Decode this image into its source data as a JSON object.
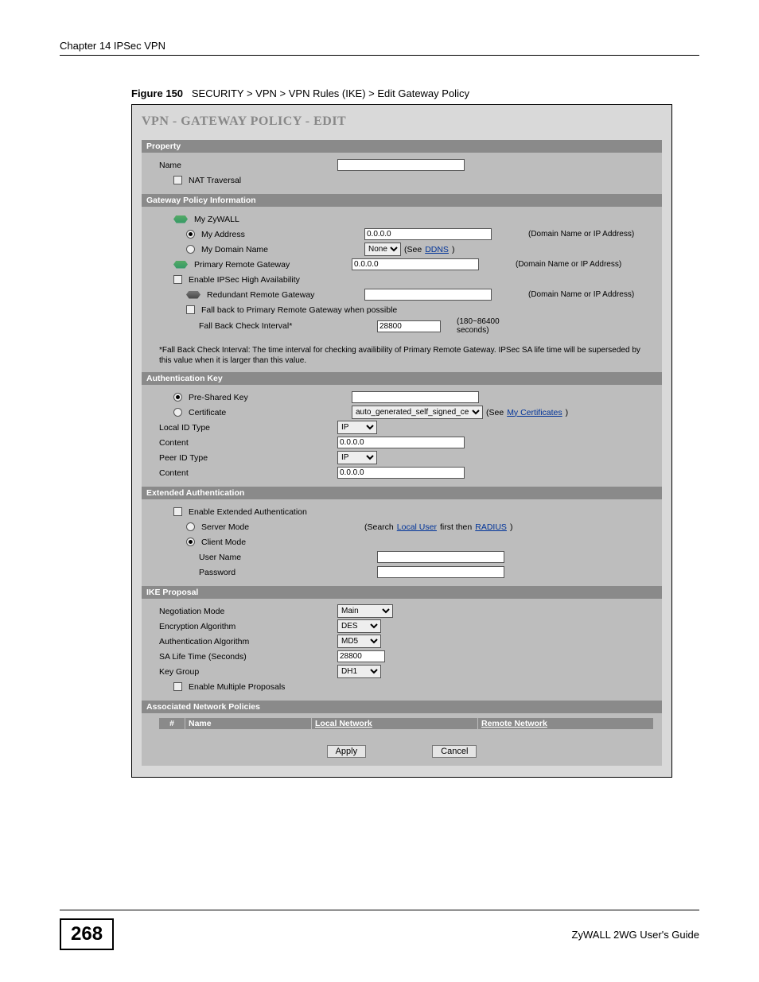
{
  "header": {
    "running": "Chapter 14 IPSec VPN"
  },
  "figure": {
    "label": "Figure 150",
    "path": "SECURITY > VPN > VPN Rules (IKE) > Edit Gateway Policy"
  },
  "panel": {
    "title": "VPN - GATEWAY POLICY - EDIT"
  },
  "property": {
    "bar": "Property",
    "name_label": "Name",
    "nat_traversal": "NAT Traversal"
  },
  "gpi": {
    "bar": "Gateway Policy Information",
    "my_zywall": "My ZyWALL",
    "my_address": "My Address",
    "my_address_value": "0.0.0.0",
    "my_domain_name": "My Domain Name",
    "domain_select": "None",
    "see": "(See ",
    "ddns": "DDNS",
    "close": ")",
    "primary_remote": "Primary Remote Gateway",
    "primary_remote_value": "0.0.0.0",
    "enable_ipsec_ha": "Enable IPSec High Availability",
    "redundant": "Redundant Remote Gateway",
    "fallback": "Fall back to Primary Remote Gateway when possible",
    "fallback_interval": "Fall Back Check Interval*",
    "fallback_value": "28800",
    "fallback_range": "(180~86400 seconds)",
    "hint_domain": "(Domain Name or IP Address)",
    "note": "*Fall Back Check Interval: The time interval for checking availibility of Primary Remote Gateway. IPSec SA life time will be superseded by this value when it is larger than this value."
  },
  "auth": {
    "bar": "Authentication Key",
    "psk": "Pre-Shared Key",
    "cert": "Certificate",
    "cert_value": "auto_generated_self_signed_cert",
    "see": "(See ",
    "my_certs": "My Certificates",
    "close": ")",
    "local_id_type": "Local ID Type",
    "local_id_type_value": "IP",
    "content1": "Content",
    "content1_value": "0.0.0.0",
    "peer_id_type": "Peer ID Type",
    "peer_id_type_value": "IP",
    "content2": "Content",
    "content2_value": "0.0.0.0"
  },
  "ext": {
    "bar": "Extended Authentication",
    "enable": "Enable Extended Authentication",
    "server_mode": "Server Mode",
    "search_pre": "(Search ",
    "local_user": "Local User",
    "mid": " first then ",
    "radius": "RADIUS",
    "close": ")",
    "client_mode": "Client Mode",
    "user_name": "User Name",
    "password": "Password"
  },
  "ike": {
    "bar": "IKE Proposal",
    "neg_mode": "Negotiation Mode",
    "neg_mode_value": "Main",
    "enc_alg": "Encryption Algorithm",
    "enc_alg_value": "DES",
    "auth_alg": "Authentication Algorithm",
    "auth_alg_value": "MD5",
    "sa_life": "SA Life Time (Seconds)",
    "sa_life_value": "28800",
    "key_group": "Key Group",
    "key_group_value": "DH1",
    "enable_multi": "Enable Multiple Proposals"
  },
  "assoc": {
    "bar": "Associated Network Policies",
    "th_num": "#",
    "th_name": "Name",
    "th_local": "Local Network",
    "th_remote": "Remote Network"
  },
  "buttons": {
    "apply": "Apply",
    "cancel": "Cancel"
  },
  "footer": {
    "page": "268",
    "guide": "ZyWALL 2WG User's Guide"
  }
}
